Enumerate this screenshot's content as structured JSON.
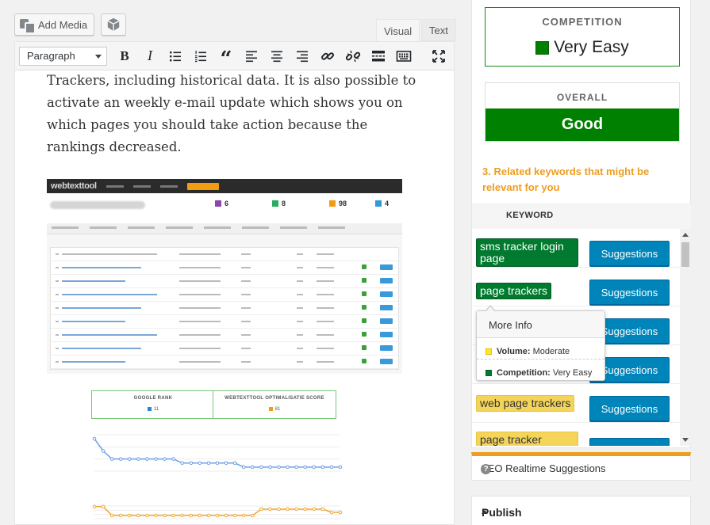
{
  "editor": {
    "add_media_label": "Add Media",
    "tabs": {
      "visual": "Visual",
      "text": "Text"
    },
    "format_select_value": "Paragraph",
    "content_text": "Trackers, including historical data. It is also possible to activate an weekly e-mail update which shows you on which pages you should take action because the rankings decreased.",
    "screenshot": {
      "logo": "webtexttool",
      "stats": [
        "6",
        "8",
        "98",
        "4"
      ],
      "google_rank_label": "GOOGLE RANK",
      "google_rank_value": "11",
      "score_label": "WEBTEXTTOOL OPTIMALISATIE SCORE",
      "score_value": "81",
      "rank_series": [
        17,
        14,
        12,
        12,
        12,
        12,
        12,
        12,
        12,
        12,
        11,
        11,
        11,
        11,
        11,
        11,
        11,
        10,
        10,
        10,
        10,
        10,
        10,
        10,
        10,
        10,
        10,
        10,
        10
      ],
      "score_series": [
        98,
        98,
        70,
        70,
        70,
        70,
        70,
        70,
        70,
        70,
        70,
        70,
        70,
        70,
        70,
        70,
        70,
        70,
        70,
        90,
        90,
        90,
        90,
        90,
        90,
        90,
        90,
        80,
        80
      ]
    }
  },
  "seo": {
    "competition_label": "COMPETITION",
    "competition_value": "Very Easy",
    "overall_label": "OVERALL",
    "overall_value": "Good",
    "related_heading": "3. Related keywords that might be relevant for you",
    "keyword_column": "KEYWORD",
    "suggestions_label": "Suggestions",
    "keywords": [
      {
        "text": "sms tracker login page",
        "color": "green"
      },
      {
        "text": "page trackers",
        "color": "green"
      },
      {
        "text": "",
        "color": "green"
      },
      {
        "text": "",
        "color": "green"
      },
      {
        "text": "web page trackers",
        "color": "yellow"
      },
      {
        "text": "page tracker",
        "color": "yellow"
      }
    ],
    "tooltip": {
      "title": "More Info",
      "volume_label": "Volume:",
      "volume_value": "Moderate",
      "competition_label": "Competition:",
      "competition_value": "Very Easy"
    },
    "panel_title": "SEO Realtime Suggestions",
    "help_glyph": "?"
  },
  "publish": {
    "title": "Publish"
  },
  "colors": {
    "green": "#008000",
    "yellow": "#f4d55a",
    "orange": "#ee9d1f",
    "blue": "#0085ba"
  }
}
